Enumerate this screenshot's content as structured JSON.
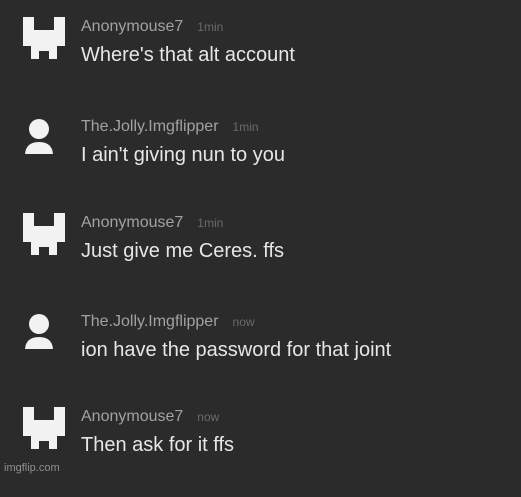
{
  "messages": [
    {
      "username": "Anonymouse7",
      "time": "1min",
      "text": "Where's that alt account",
      "avatar_icon": "pixel-avatar-icon"
    },
    {
      "username": "The.Jolly.Imgflipper",
      "time": "1min",
      "text": "I ain't giving nun to you",
      "avatar_icon": "default-user-icon"
    },
    {
      "username": "Anonymouse7",
      "time": "1min",
      "text": "Just give me Ceres. ffs",
      "avatar_icon": "pixel-avatar-icon"
    },
    {
      "username": "The.Jolly.Imgflipper",
      "time": "now",
      "text": "ion have the password for that joint",
      "avatar_icon": "default-user-icon"
    },
    {
      "username": "Anonymouse7",
      "time": "now",
      "text": "Then ask for it ffs",
      "avatar_icon": "pixel-avatar-icon"
    }
  ],
  "watermark": "imgflip.com",
  "colors": {
    "background": "#2b2b2b",
    "username": "#a2a2a2",
    "timestamp": "#6a6a6a",
    "message_text": "#e6e6e6",
    "avatar": "#f2f2f2"
  }
}
